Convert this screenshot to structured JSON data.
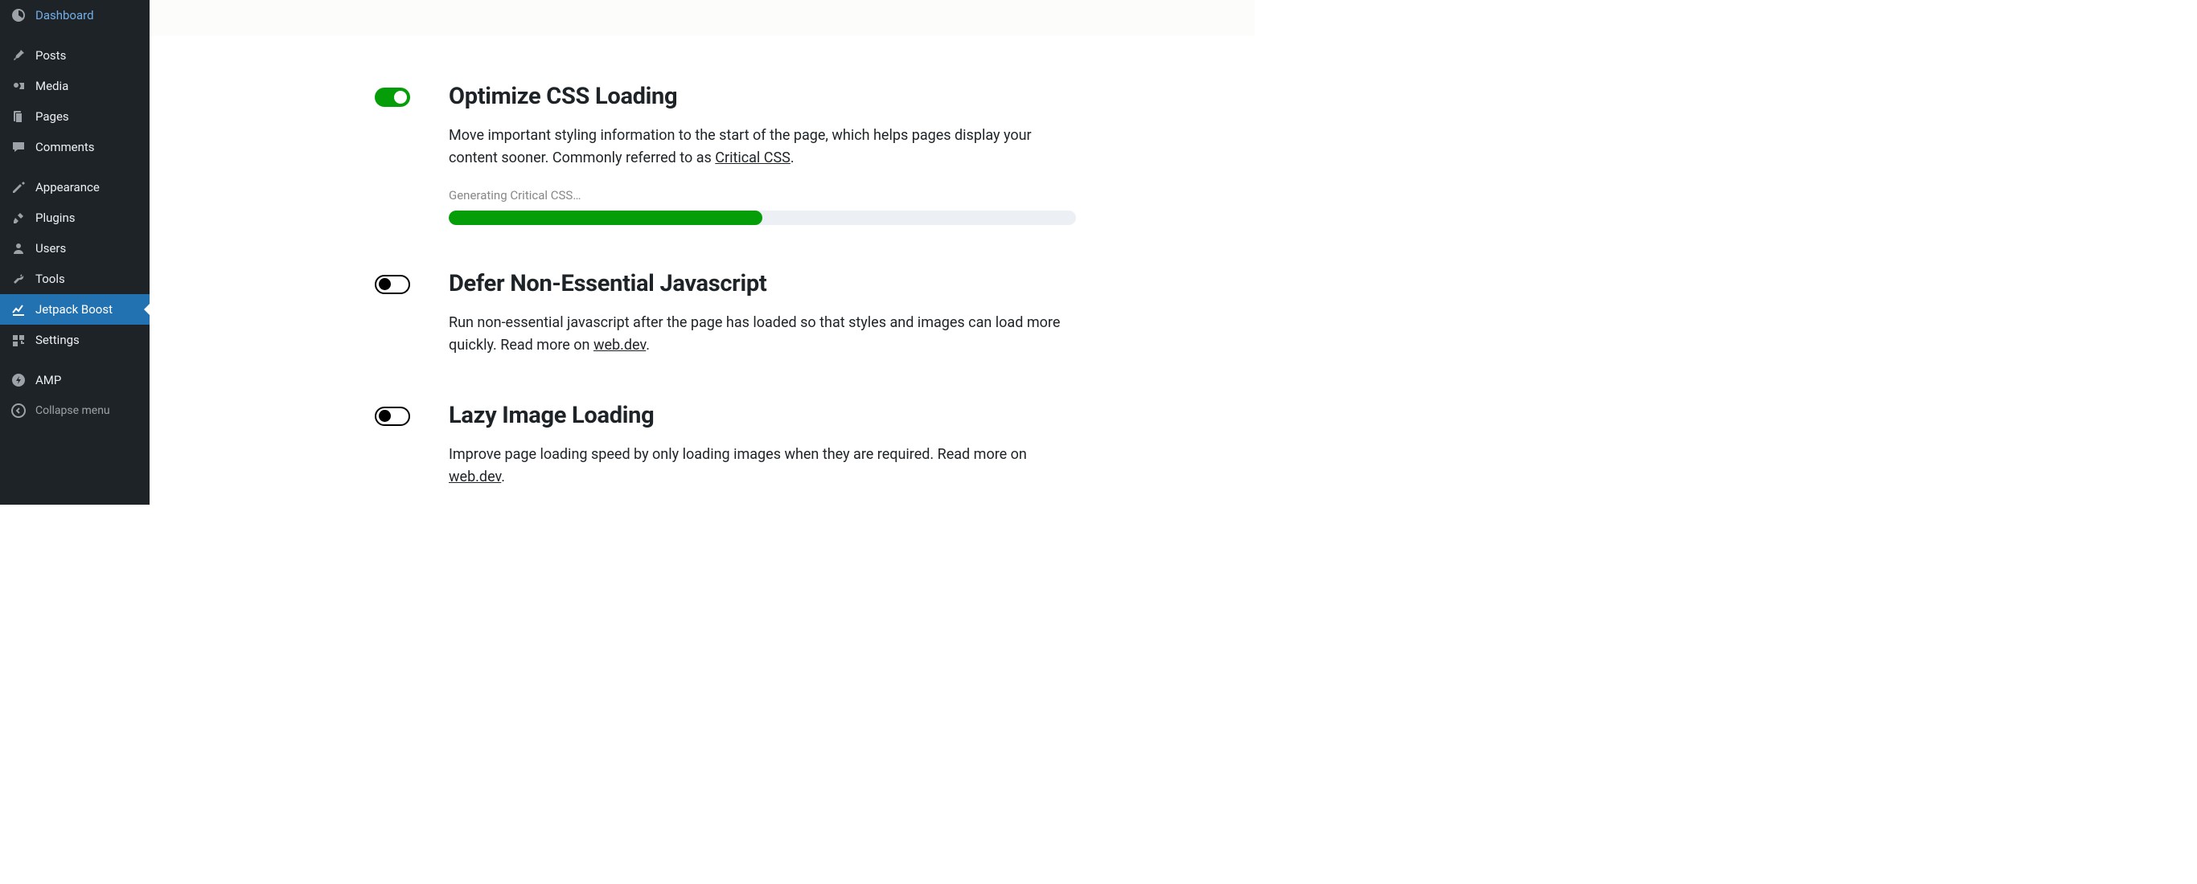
{
  "sidebar": {
    "items": [
      {
        "label": "Dashboard"
      },
      {
        "label": "Posts"
      },
      {
        "label": "Media"
      },
      {
        "label": "Pages"
      },
      {
        "label": "Comments"
      },
      {
        "label": "Appearance"
      },
      {
        "label": "Plugins"
      },
      {
        "label": "Users"
      },
      {
        "label": "Tools"
      },
      {
        "label": "Jetpack Boost"
      },
      {
        "label": "Settings"
      },
      {
        "label": "AMP"
      },
      {
        "label": "Collapse menu"
      }
    ]
  },
  "settings": {
    "optimize_css": {
      "title": "Optimize CSS Loading",
      "desc_pre": "Move important styling information to the start of the page, which helps pages display your content sooner. Commonly referred to as ",
      "link_text": "Critical CSS",
      "desc_post": ".",
      "progress_label": "Generating Critical CSS…",
      "progress_percent": 50
    },
    "defer_js": {
      "title": "Defer Non-Essential Javascript",
      "desc_pre": "Run non-essential javascript after the page has loaded so that styles and images can load more quickly. Read more on ",
      "link_text": "web.dev",
      "desc_post": "."
    },
    "lazy_images": {
      "title": "Lazy Image Loading",
      "desc_pre": "Improve page loading speed by only loading images when they are required. Read more on ",
      "link_text": "web.dev",
      "desc_post": "."
    }
  }
}
